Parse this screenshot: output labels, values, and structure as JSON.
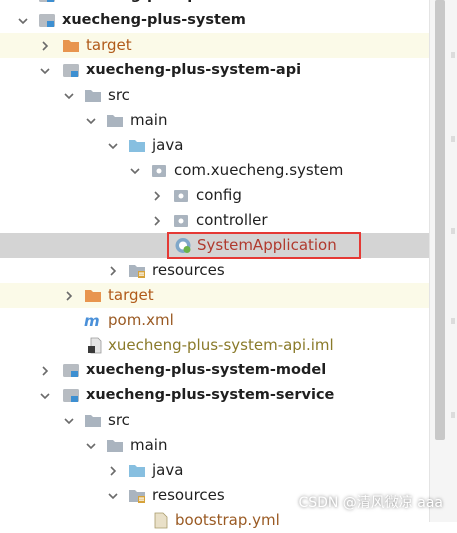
{
  "tree": {
    "rows": [
      {
        "label": "xuecheng-plus-parent",
        "kind": "module"
      },
      {
        "label": "xuecheng-plus-system",
        "kind": "module"
      },
      {
        "label": "target",
        "kind": "excluded-folder"
      },
      {
        "label": "xuecheng-plus-system-api",
        "kind": "module"
      },
      {
        "label": "src",
        "kind": "folder"
      },
      {
        "label": "main",
        "kind": "folder"
      },
      {
        "label": "java",
        "kind": "source-root"
      },
      {
        "label": "com.xuecheng.system",
        "kind": "package"
      },
      {
        "label": "config",
        "kind": "package"
      },
      {
        "label": "controller",
        "kind": "package"
      },
      {
        "label": "SystemApplication",
        "kind": "spring-class"
      },
      {
        "label": "resources",
        "kind": "resources"
      },
      {
        "label": "target",
        "kind": "excluded-folder"
      },
      {
        "label": "pom.xml",
        "kind": "maven-file"
      },
      {
        "label": "xuecheng-plus-system-api.iml",
        "kind": "iml-file"
      },
      {
        "label": "xuecheng-plus-system-model",
        "kind": "module"
      },
      {
        "label": "xuecheng-plus-system-service",
        "kind": "module"
      },
      {
        "label": "src",
        "kind": "folder"
      },
      {
        "label": "main",
        "kind": "folder"
      },
      {
        "label": "java",
        "kind": "source-root"
      },
      {
        "label": "resources",
        "kind": "resources"
      },
      {
        "label": "bootstrap.yml",
        "kind": "yaml-file"
      }
    ]
  },
  "watermark": "CSDN @清风微凉 aaa",
  "colors": {
    "selection_box": "#e53935",
    "selected_row": "#d4d4d4",
    "excluded_row": "#fbfae8",
    "excluded_label": "#b05a1a",
    "folder_blue": "#87bfe0",
    "folder_orange": "#e8954f"
  }
}
